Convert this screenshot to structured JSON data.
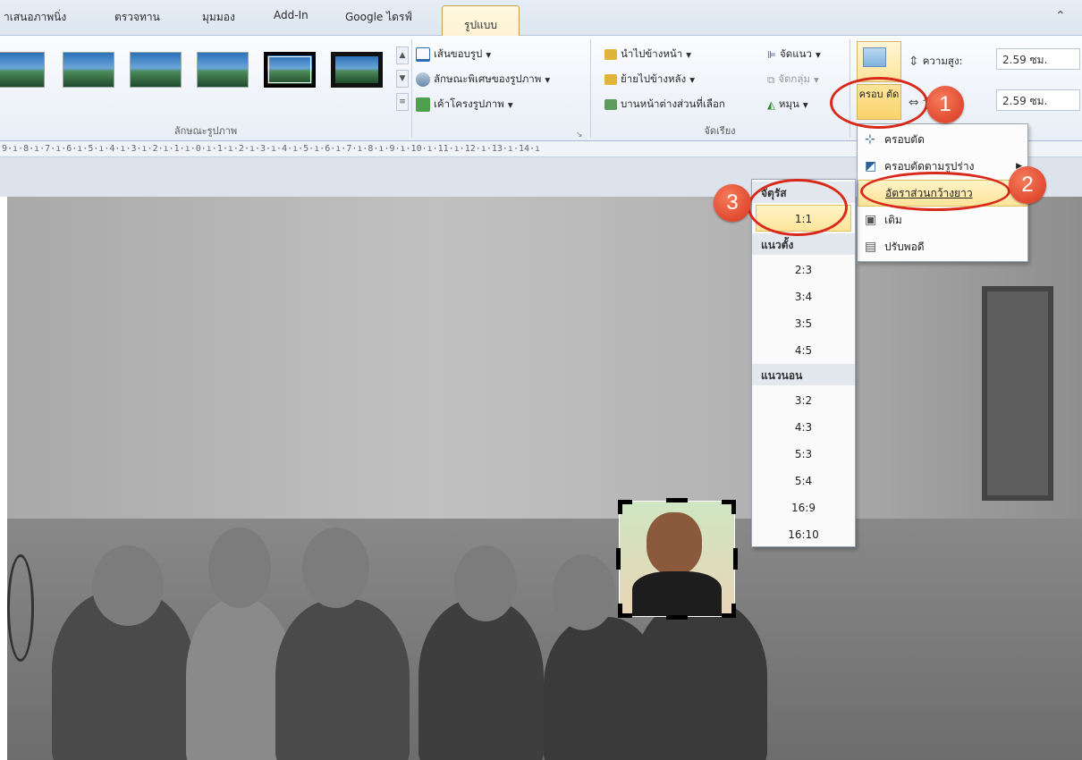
{
  "tabs": [
    {
      "label": "าเสนอภาพนิ่ง"
    },
    {
      "label": "ตรวจทาน"
    },
    {
      "label": "มุมมอง"
    },
    {
      "label": "Add-In"
    },
    {
      "label": "Google ไดรฟ์"
    },
    {
      "label": "รูปแบบ",
      "active": true
    }
  ],
  "ribbon": {
    "styles_group_label": "ลักษณะรูปภาพ",
    "picture_border": "เส้นขอบรูป",
    "picture_effects": "ลักษณะพิเศษของรูปภาพ",
    "picture_layout": "เค้าโครงรูปภาพ",
    "arrange": {
      "bring_forward": "นำไปข้างหน้า",
      "send_backward": "ย้ายไปข้างหลัง",
      "selection_pane": "บานหน้าต่างส่วนที่เลือก",
      "align": "จัดแนว",
      "group": "จัดกลุ่ม",
      "rotate": "หมุน",
      "group_label": "จัดเรียง"
    },
    "crop_button": "ครอบ ตัด",
    "height_label": "ความสูง:",
    "height_value": "2.59 ซม.",
    "width_label": "ว้าง:",
    "width_value": "2.59 ซม."
  },
  "ruler_text": "9·ı·8·ı·7·ı·6·ı·5·ı·4·ı·3·ı·2·ı·1·ı·0·ı·1·ı·2·ı·3·ı·4·ı·5·ı·6·ı·7·ı·8·ı·9·ı·10·ı·11·ı·12·ı·13·ı·14·ı",
  "crop_menu": [
    {
      "label": "ครอบตัด"
    },
    {
      "label": "ครอบตัดตามรูปร่าง"
    },
    {
      "label": "อัตราส่วนกว้างยาว",
      "highlighted": true
    },
    {
      "label": "เติม"
    },
    {
      "label": "ปรับพอดี"
    }
  ],
  "ratio_menu": {
    "square_header": "จัตุรัส",
    "square_items": [
      "1:1"
    ],
    "portrait_header": "แนวตั้ง",
    "portrait_items": [
      "2:3",
      "3:4",
      "3:5",
      "4:5"
    ],
    "landscape_header": "แนวนอน",
    "landscape_items": [
      "3:2",
      "4:3",
      "5:3",
      "5:4",
      "16:9",
      "16:10"
    ]
  },
  "badges": [
    "1",
    "2",
    "3"
  ],
  "colors": {
    "accent_red": "#d8291b",
    "highlight": "#fde49a"
  }
}
